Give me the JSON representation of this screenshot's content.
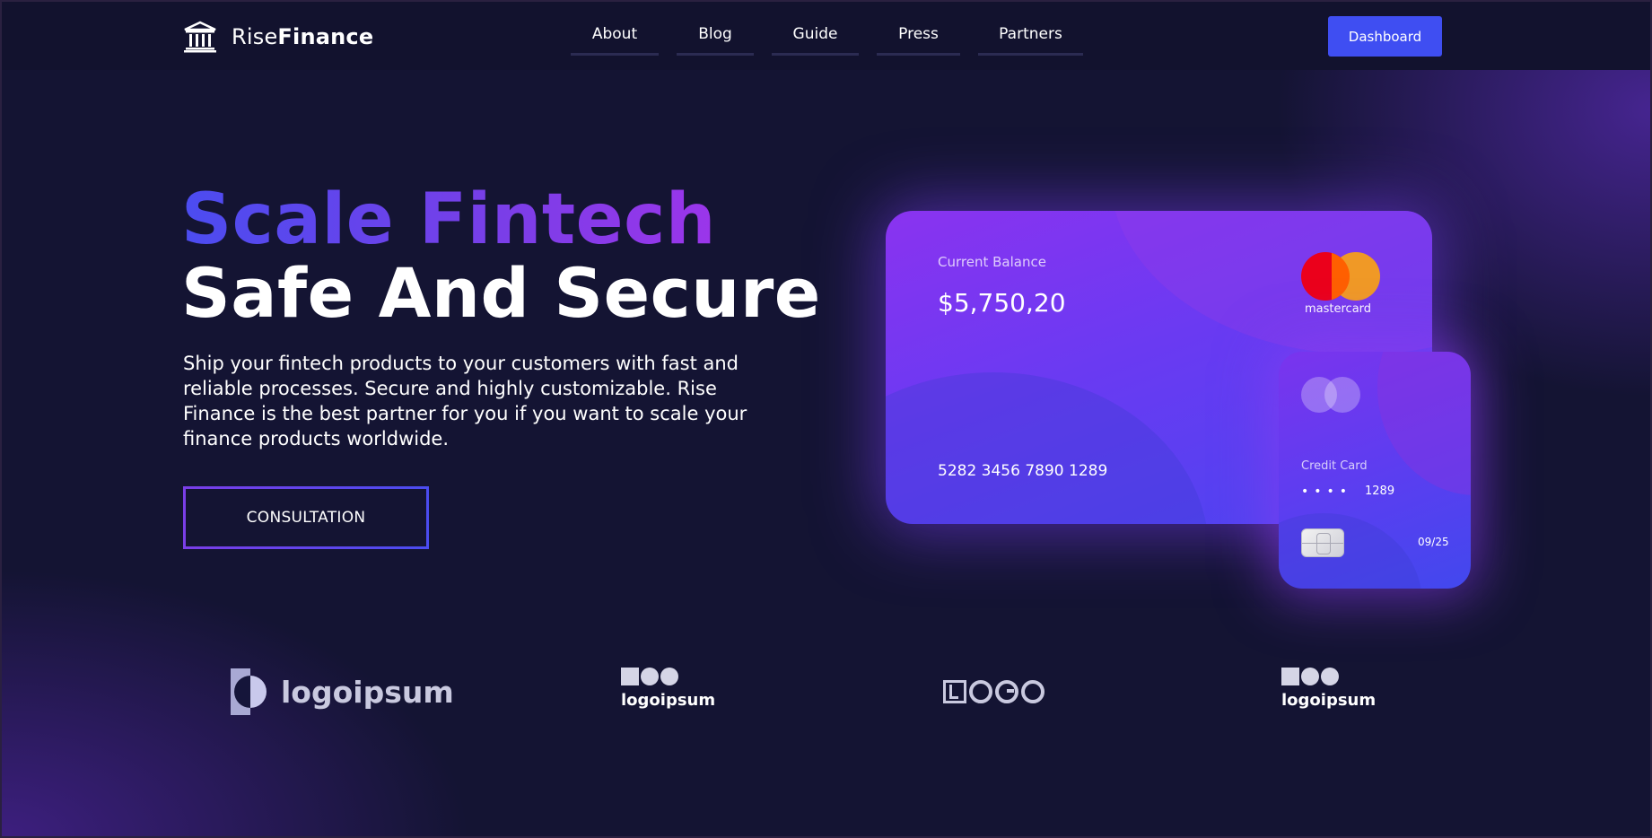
{
  "brand": {
    "name_light": "Rise",
    "name_bold": "Finance"
  },
  "nav": {
    "items": [
      {
        "label": "About"
      },
      {
        "label": "Blog"
      },
      {
        "label": "Guide"
      },
      {
        "label": "Press"
      },
      {
        "label": "Partners"
      }
    ],
    "cta_label": "Dashboard"
  },
  "hero": {
    "title_line1": "Scale Fintech",
    "title_line2": "Safe And Secure",
    "description": "Ship your fintech products to your customers with fast and reliable processes. Secure and highly customizable. Rise Finance is the best partner for you if you want to scale your finance products worldwide.",
    "button_label": "CONSULTATION"
  },
  "card_main": {
    "label": "Current Balance",
    "amount": "$5,750,20",
    "number": "5282 3456 7890 1289",
    "network": "mastercard"
  },
  "card_secondary": {
    "label": "Credit Card",
    "masked": "••••",
    "last_digits": "1289",
    "expiry": "09/25"
  },
  "partners": [
    {
      "name": "logoipsum"
    },
    {
      "name": "logoipsum"
    },
    {
      "name": "LOGO"
    },
    {
      "name": "logoipsum"
    }
  ],
  "colors": {
    "background": "#141433",
    "accent": "#3f4ef2",
    "gradient_start": "#4b4cf0",
    "gradient_end": "#9b35ea"
  }
}
